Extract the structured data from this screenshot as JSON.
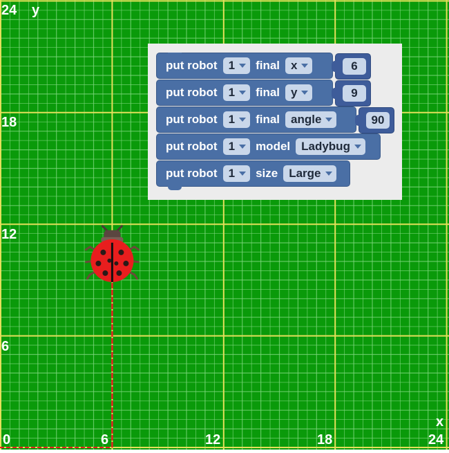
{
  "colors": {
    "grass": "#0a9a0a",
    "grid_line": "#7fd87f",
    "major_line": "#e5e05a",
    "path_line": "#e8231f",
    "block_fill": "#4a6fa5",
    "workspace_bg": "#ececec"
  },
  "axes": {
    "x_name": "x",
    "y_name": "y",
    "x_ticks": [
      "0",
      "6",
      "12",
      "18",
      "24"
    ],
    "y_ticks": [
      "6",
      "12",
      "18",
      "24"
    ],
    "range": [
      0,
      24
    ]
  },
  "robot": {
    "icon": "ladybug-icon",
    "x": 6,
    "y": 9,
    "angle": 90,
    "start_x": 6,
    "start_y": 0
  },
  "blocks": [
    {
      "prefix": "put robot",
      "robot_id": "1",
      "keyword": "final",
      "param": "x",
      "value": "6"
    },
    {
      "prefix": "put robot",
      "robot_id": "1",
      "keyword": "final",
      "param": "y",
      "value": "9"
    },
    {
      "prefix": "put robot",
      "robot_id": "1",
      "keyword": "final",
      "param": "angle",
      "value": "90"
    },
    {
      "prefix": "put robot",
      "robot_id": "1",
      "keyword": "model",
      "param": "Ladybug",
      "value": ""
    },
    {
      "prefix": "put robot",
      "robot_id": "1",
      "keyword": "size",
      "param": "Large",
      "value": ""
    }
  ]
}
